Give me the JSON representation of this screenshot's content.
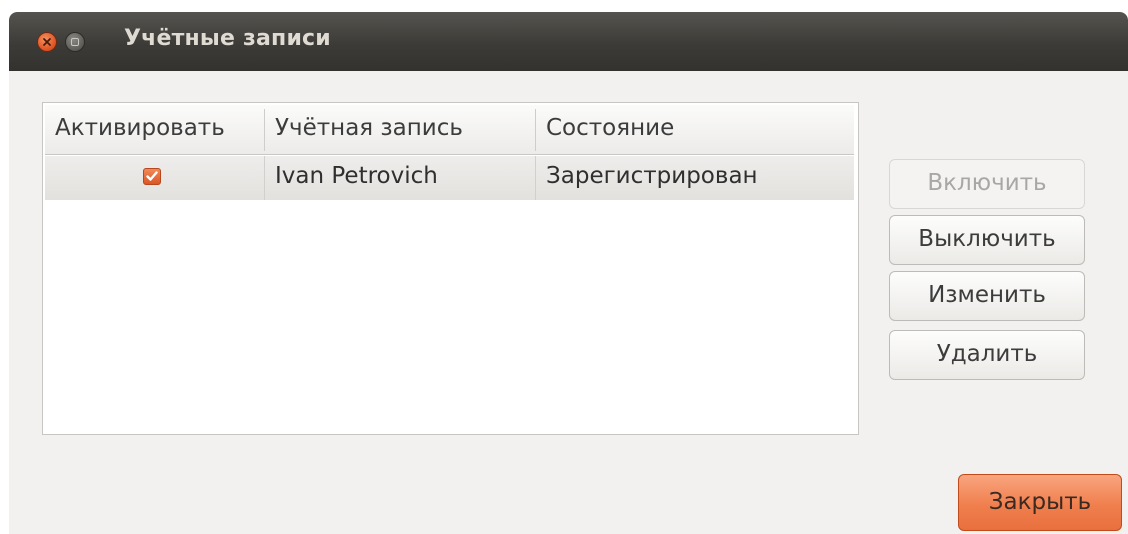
{
  "window": {
    "title": "Учётные записи"
  },
  "table": {
    "columns": [
      "Активировать",
      "Учётная запись",
      "Состояние"
    ],
    "rows": [
      {
        "active": true,
        "account": "Ivan Petrovich",
        "status": "Зарегистрирован"
      }
    ]
  },
  "buttons": {
    "enable": "Включить",
    "disable": "Выключить",
    "edit": "Изменить",
    "delete": "Удалить",
    "close": "Закрыть"
  },
  "colors": {
    "accent": "#f07f4e",
    "titlebar": "#3c3b37",
    "checkbox": "#dd5524"
  },
  "icons": {
    "close": "close-icon",
    "maximize": "maximize-icon",
    "checkbox": "checkbox-checked-icon"
  }
}
